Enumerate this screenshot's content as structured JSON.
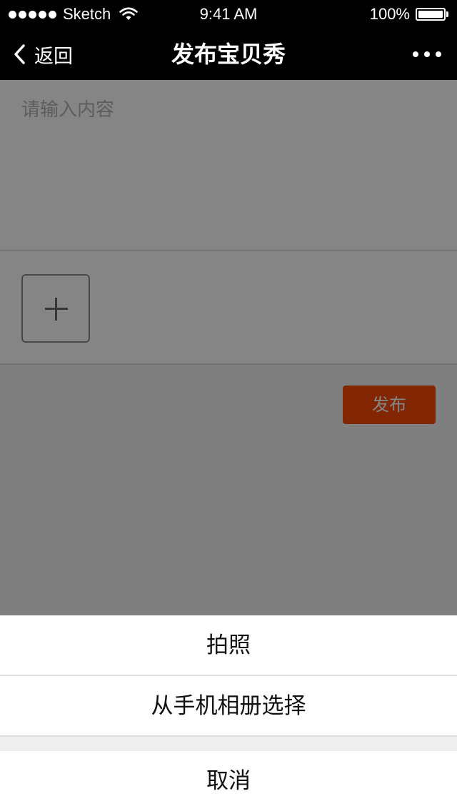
{
  "status_bar": {
    "carrier": "Sketch",
    "time": "9:41 AM",
    "battery": "100%",
    "battery_level": 1.0,
    "signal_icon": "signal-dots-icon",
    "wifi_icon": "wifi-icon",
    "battery_icon": "battery-icon"
  },
  "nav": {
    "back_label": "返回",
    "back_icon": "chevron-left-icon",
    "title": "发布宝贝秀",
    "more_icon": "more-dots-icon"
  },
  "editor": {
    "placeholder": "请输入内容",
    "value": ""
  },
  "upload": {
    "add_icon": "plus-icon"
  },
  "publish": {
    "label": "发布",
    "color": "#fa4a08"
  },
  "action_sheet": {
    "options": [
      {
        "label": "拍照"
      },
      {
        "label": "从手机相册选择"
      }
    ],
    "cancel_label": "取消"
  }
}
